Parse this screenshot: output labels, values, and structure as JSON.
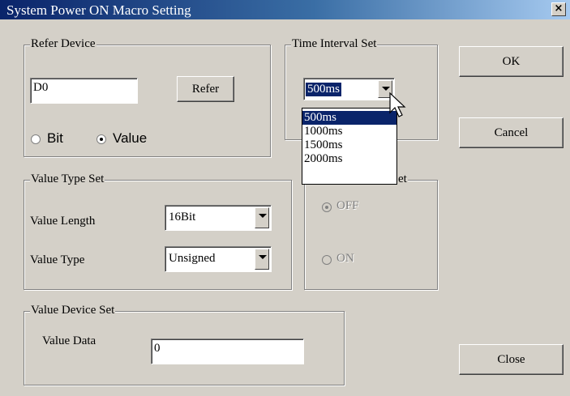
{
  "window": {
    "title": "System Power ON Macro Setting",
    "close_glyph": "×"
  },
  "refer_device": {
    "legend": "Refer Device",
    "device_value": "D0",
    "refer_button": "Refer",
    "radio_bit": "Bit",
    "radio_value": "Value",
    "selected": "Value"
  },
  "time_interval": {
    "legend": "Time Interval Set",
    "selected": "500ms",
    "options": [
      "500ms",
      "1000ms",
      "1500ms",
      "2000ms"
    ],
    "highlighted": "500ms"
  },
  "buttons": {
    "ok": "OK",
    "cancel": "Cancel",
    "close": "Close"
  },
  "value_type": {
    "legend": "Value Type Set",
    "length_label": "Value Length",
    "length_value": "16Bit",
    "type_label": "Value Type",
    "type_value": "Unsigned"
  },
  "hidden_group": {
    "legend_tail": "et",
    "off_label": "OFF",
    "on_label": "ON",
    "selected": "OFF"
  },
  "value_device": {
    "legend": "Value Device Set",
    "data_label": "Value Data",
    "data_value": "0"
  }
}
